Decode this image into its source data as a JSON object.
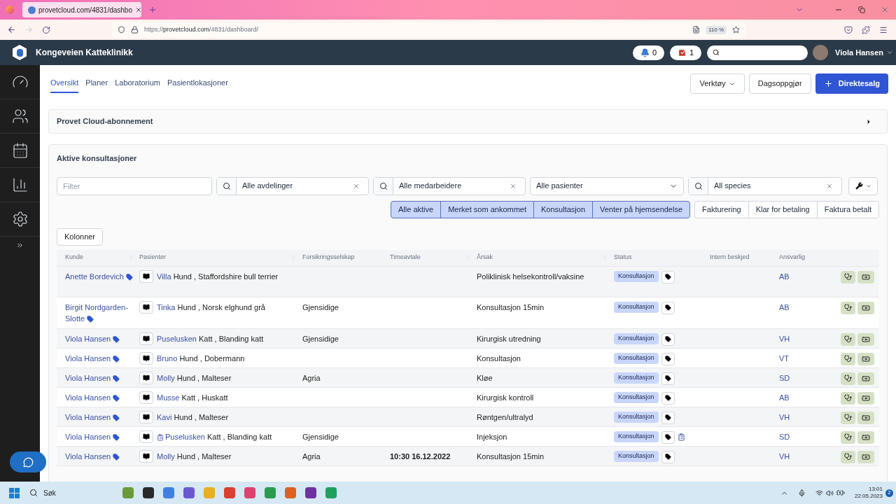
{
  "browser": {
    "tab_title": "provetcloud.com/4831/dashbo",
    "url_host": "provetcloud.com",
    "url_prefix": "https://",
    "url_path": "/4831/dashboard/",
    "zoom": "110 %"
  },
  "header": {
    "clinic": "Kongeveien Katteklinikk",
    "notifications": "0",
    "tasks": "1",
    "user": "Viola Hansen"
  },
  "tabs": [
    {
      "label": "Oversikt",
      "selected": true
    },
    {
      "label": "Planer",
      "selected": false
    },
    {
      "label": "Laboratorium",
      "selected": false
    },
    {
      "label": "Pasientlokasjoner",
      "selected": false
    }
  ],
  "actions": [
    {
      "label": "Verktøy",
      "kind": "dropdown"
    },
    {
      "label": "Dagsoppgjør",
      "kind": "plain"
    },
    {
      "label": "Direktesalg",
      "kind": "primary"
    }
  ],
  "subscription_panel": {
    "title": "Provet Cloud-abonnement",
    "expanded": false
  },
  "consultations": {
    "title": "Aktive konsultasjoner",
    "filters": [
      {
        "kind": "text",
        "placeholder": "Filter"
      },
      {
        "kind": "search",
        "value": "Alle avdelinger"
      },
      {
        "kind": "search",
        "value": "Alle medarbeidere"
      },
      {
        "kind": "select",
        "value": "Alle pasienter"
      },
      {
        "kind": "search",
        "value": "All species"
      }
    ],
    "status_groups": [
      [
        {
          "label": "Alle aktive",
          "selected": true
        },
        {
          "label": "Merket som ankommet",
          "selected": true
        },
        {
          "label": "Konsultasjon",
          "selected": true
        },
        {
          "label": "Venter på hjemsendelse",
          "selected": true
        }
      ],
      [
        {
          "label": "Fakturering",
          "selected": false
        },
        {
          "label": "Klar for betaling",
          "selected": false
        },
        {
          "label": "Faktura betalt",
          "selected": false
        }
      ]
    ],
    "columns_button": "Kolonner",
    "columns": [
      {
        "label": "Kunde",
        "sortable": true
      },
      {
        "label": "Pasienter",
        "sortable": true
      },
      {
        "label": "Forsikringsselskap",
        "sortable": false
      },
      {
        "label": "Timeavtale",
        "sortable": true
      },
      {
        "label": "Årsak",
        "sortable": true
      },
      {
        "label": "Status",
        "sortable": false
      },
      {
        "label": "Intern beskjed",
        "sortable": false
      },
      {
        "label": "Ansvarlig",
        "sortable": false
      }
    ],
    "rows": [
      {
        "client": "Anette Bordevich",
        "patient": "Villa",
        "details": "Hund , Staffordshire bull terrier",
        "insurer": "",
        "appointment": "",
        "reason": "Poliklinisk helsekontroll/vaksine",
        "status": "Konsultasjon",
        "note": false,
        "responsible": "AB"
      },
      {
        "client": "Birgit Nordgarden-Slotte",
        "patient": "Tinka",
        "details": "Hund , Norsk elghund grå",
        "insurer": "Gjensidige",
        "appointment": "",
        "reason": "Konsultasjon 15min",
        "status": "Konsultasjon",
        "note": false,
        "responsible": "AB"
      },
      {
        "client": "Viola Hansen",
        "patient": "Puselusken",
        "details": "Katt , Blanding katt",
        "insurer": "Gjensidige",
        "appointment": "",
        "reason": "Kirurgisk utredning",
        "status": "Konsultasjon",
        "note": false,
        "responsible": "VH"
      },
      {
        "client": "Viola Hansen",
        "patient": "Bruno",
        "details": "Hund , Dobermann",
        "insurer": "",
        "appointment": "",
        "reason": "Konsultasjon",
        "status": "Konsultasjon",
        "note": false,
        "responsible": "VT"
      },
      {
        "client": "Viola Hansen",
        "patient": "Molly",
        "details": "Hund , Malteser",
        "insurer": "Agria",
        "appointment": "",
        "reason": "Kløe",
        "status": "Konsultasjon",
        "note": false,
        "responsible": "SD"
      },
      {
        "client": "Viola Hansen",
        "patient": "Musse",
        "details": "Katt , Huskatt",
        "insurer": "",
        "appointment": "",
        "reason": "Kirurgisk kontroll",
        "status": "Konsultasjon",
        "note": false,
        "responsible": "AB"
      },
      {
        "client": "Viola Hansen",
        "patient": "Kavi",
        "details": "Hund , Malteser",
        "insurer": "",
        "appointment": "",
        "reason": "Røntgen/ultralyd",
        "status": "Konsultasjon",
        "note": false,
        "responsible": "VH"
      },
      {
        "client": "Viola Hansen",
        "patient": "Puselusken",
        "details": "Katt , Blanding katt",
        "insurer": "Gjensidige",
        "appointment": "",
        "reason": "Injeksjon",
        "status": "Konsultasjon",
        "note": true,
        "responsible": "SD"
      },
      {
        "client": "Viola Hansen",
        "patient": "Molly",
        "details": "Hund , Malteser",
        "insurer": "Agria",
        "appointment": "10:30 16.12.2022",
        "reason": "Konsultasjon 15min",
        "status": "Konsultasjon",
        "note": false,
        "responsible": "VH"
      }
    ]
  },
  "taskbar": {
    "search": "Søk",
    "time": "13:01",
    "date": "22.05.2023",
    "notifications": "2"
  }
}
